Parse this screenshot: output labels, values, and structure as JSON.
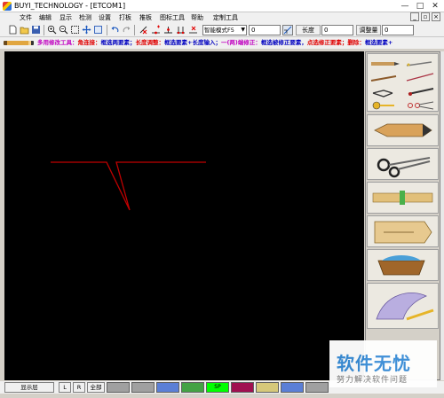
{
  "window": {
    "title": "BUYI_TECHNOLOGY - [ETCOM1]",
    "controls": [
      "—",
      "□",
      "✕"
    ]
  },
  "menu": {
    "items": [
      "文件",
      "编辑",
      "显示",
      "检测",
      "设置",
      "打板",
      "推板",
      "图标工具",
      "帮助",
      "定制工具"
    ],
    "mdi_controls": [
      "_",
      "▫",
      "×"
    ]
  },
  "toolbar": {
    "mode_select": "智能模式F5",
    "value_input": "0",
    "length_label": "长度",
    "length_input": "0",
    "adjust_label": "调整量",
    "adjust_input": "0"
  },
  "hint": {
    "tool_name": "多用修改工具：",
    "s1_label": "角连接：",
    "s1_text": "框选两要素；",
    "s2_label": "长度调整：",
    "s2_text": "框选要素+长度输入；",
    "s3_label": "一(两)端修正：",
    "s3_text": "框选被修正要素，",
    "s3_text2": "点选修正要素；",
    "s4_label": "删除：",
    "s4_text": "框选要素+"
  },
  "canvas": {
    "background": "#000000",
    "line_color": "#c00000"
  },
  "side_tools": [
    {
      "name": "pen-tool-grid"
    },
    {
      "name": "pencil"
    },
    {
      "name": "scissors"
    },
    {
      "name": "ruler"
    },
    {
      "name": "pattern-piece"
    },
    {
      "name": "fabric-basket"
    },
    {
      "name": "french-curve"
    }
  ],
  "status": {
    "layer_button": "显示层",
    "l_button": "L",
    "r_button": "R",
    "all_button": "全部",
    "swatch_label": "SP",
    "swatch_colors": [
      "#a0a0a0",
      "#a0a0a0",
      "#5b7fd6",
      "#44a244",
      "#00ff00",
      "#a01050",
      "#d6c87a",
      "#5b7fd6",
      "#a0a0a0"
    ]
  },
  "watermark": {
    "main": "软件无忧",
    "sub": "努力解决软件问题"
  }
}
